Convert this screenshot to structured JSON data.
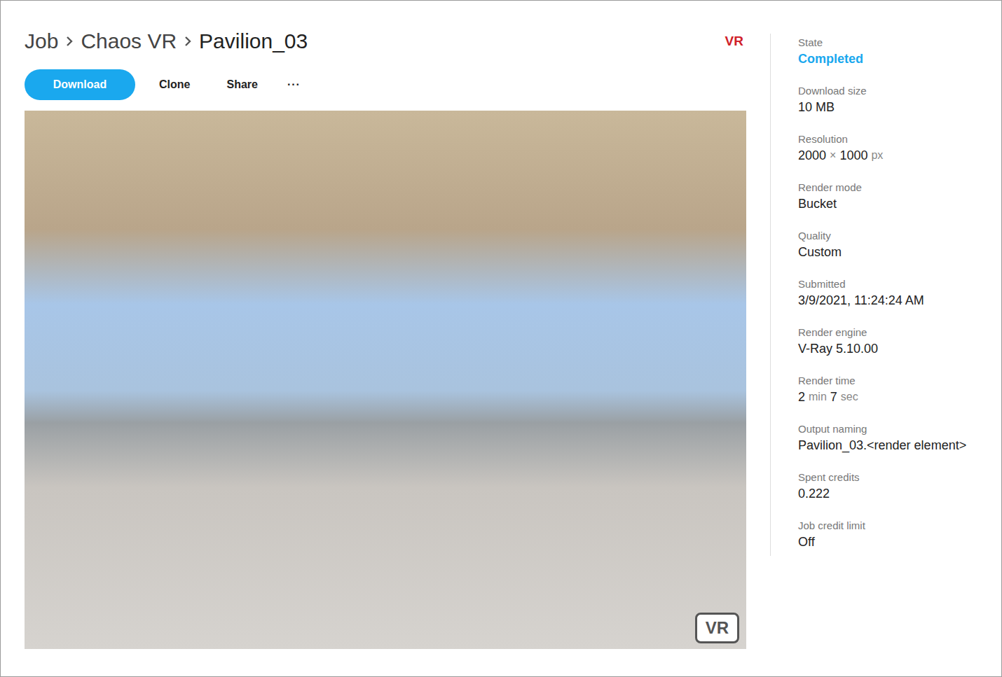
{
  "breadcrumb": [
    "Job",
    "Chaos VR",
    "Pavilion_03"
  ],
  "header_badge": "VR",
  "actions": [
    {
      "label": "Download",
      "primary": true
    },
    {
      "label": "Clone",
      "primary": false
    },
    {
      "label": "Share",
      "primary": false
    }
  ],
  "more_menu": "···",
  "preview": {
    "badge": "VR"
  },
  "details": [
    {
      "label": "State",
      "emphasis": true,
      "parts": [
        {
          "text": "Completed",
          "muted": false
        }
      ]
    },
    {
      "label": "Download size",
      "emphasis": false,
      "parts": [
        {
          "text": "10 MB",
          "muted": false
        }
      ]
    },
    {
      "label": "Resolution",
      "emphasis": false,
      "parts": [
        {
          "text": "2000",
          "muted": false
        },
        {
          "text": "×",
          "muted": true
        },
        {
          "text": "1000",
          "muted": false
        },
        {
          "text": "px",
          "muted": true
        }
      ]
    },
    {
      "label": "Render mode",
      "emphasis": false,
      "parts": [
        {
          "text": "Bucket",
          "muted": false
        }
      ]
    },
    {
      "label": "Quality",
      "emphasis": false,
      "parts": [
        {
          "text": "Custom",
          "muted": false
        }
      ]
    },
    {
      "label": "Submitted",
      "emphasis": false,
      "parts": [
        {
          "text": "3/9/2021, 11:24:24 AM",
          "muted": false
        }
      ]
    },
    {
      "label": "Render engine",
      "emphasis": false,
      "parts": [
        {
          "text": "V-Ray 5.10.00",
          "muted": false
        }
      ]
    },
    {
      "label": "Render time",
      "emphasis": false,
      "parts": [
        {
          "text": "2",
          "muted": false
        },
        {
          "text": "min",
          "muted": true
        },
        {
          "text": "7",
          "muted": false
        },
        {
          "text": "sec",
          "muted": true
        }
      ]
    },
    {
      "label": "Output naming",
      "emphasis": false,
      "parts": [
        {
          "text": "Pavilion_03.<render element>",
          "muted": false
        }
      ]
    },
    {
      "label": "Spent credits",
      "emphasis": false,
      "parts": [
        {
          "text": "0.222",
          "muted": false
        }
      ]
    },
    {
      "label": "Job credit limit",
      "emphasis": false,
      "parts": [
        {
          "text": "Off",
          "muted": false
        }
      ]
    }
  ]
}
